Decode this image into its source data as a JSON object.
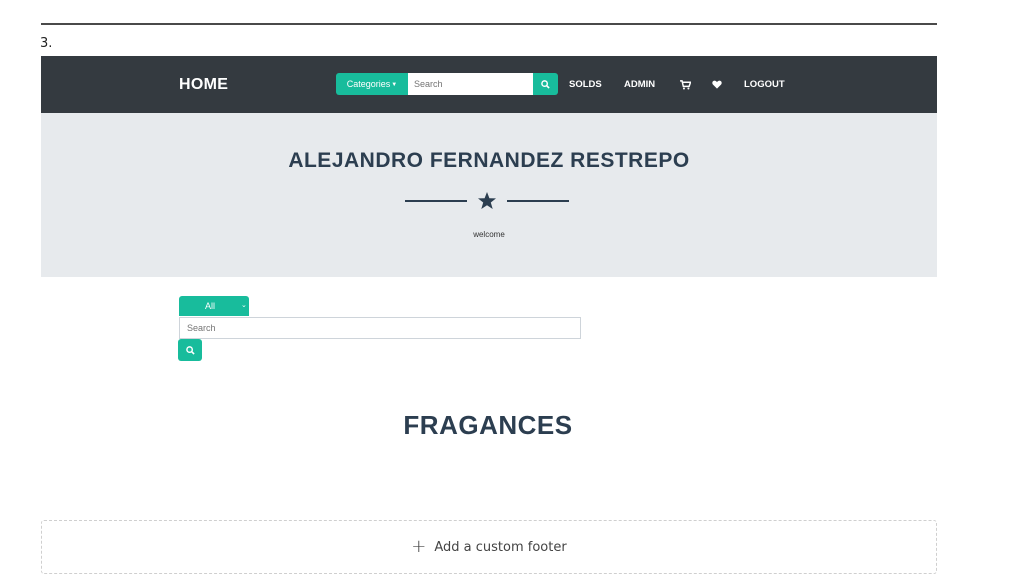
{
  "step_number": "3.",
  "navbar": {
    "brand": "HOME",
    "categories_label": "Categories",
    "search_placeholder": "Search",
    "links": {
      "solds": "SOLDS",
      "admin": "ADMIN",
      "logout": "LOGOUT"
    },
    "icons": [
      "cart-icon",
      "heart-icon",
      "search-icon"
    ]
  },
  "masthead": {
    "title": "ALEJANDRO FERNANDEZ RESTREPO",
    "subtitle": "welcome",
    "divider_icon": "star-icon"
  },
  "filter": {
    "selected": "All",
    "search_placeholder": "Search"
  },
  "section": {
    "title": "FRAGANCES"
  },
  "footer": {
    "add_label": "Add a custom footer"
  },
  "colors": {
    "accent": "#18bc9c",
    "navbar": "#343a40",
    "masthead": "#e7eaed",
    "heading": "#2c3e50"
  }
}
